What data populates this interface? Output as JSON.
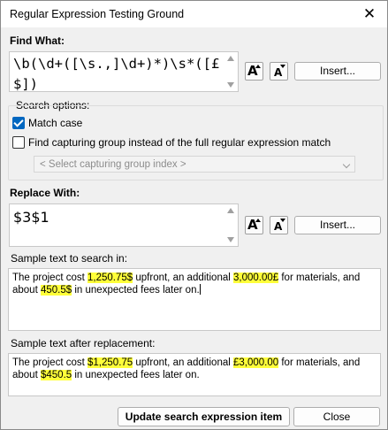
{
  "window": {
    "title": "Regular Expression Testing Ground"
  },
  "find": {
    "label": "Find What:",
    "expression": "\\b(\\d+([\\s.,]\\d+)*)\\s*([£$])",
    "insert_label": "Insert..."
  },
  "search_options": {
    "legend": "Search options:",
    "match_case": {
      "label": "Match case",
      "checked": true
    },
    "capturing_group": {
      "label": "Find capturing group instead of the full regular expression match",
      "checked": false
    },
    "group_select_placeholder": "< Select capturing group index >"
  },
  "replace": {
    "label": "Replace With:",
    "value": "$3$1",
    "insert_label": "Insert..."
  },
  "sample": {
    "label": "Sample text to search in:",
    "segments": [
      {
        "text": "The project cost ",
        "hl": false
      },
      {
        "text": "1,250.75$",
        "hl": true
      },
      {
        "text": " upfront, an additional ",
        "hl": false
      },
      {
        "text": "3,000.00£",
        "hl": true
      },
      {
        "text": " for materials, and about ",
        "hl": false
      },
      {
        "text": "450.5$",
        "hl": true
      },
      {
        "text": " in unexpected fees later on.",
        "hl": false
      }
    ]
  },
  "result": {
    "label": "Sample text after replacement:",
    "segments": [
      {
        "text": "The project cost ",
        "hl": false
      },
      {
        "text": "$1,250.75",
        "hl": true
      },
      {
        "text": " upfront, an additional ",
        "hl": false
      },
      {
        "text": "£3,000.00",
        "hl": true
      },
      {
        "text": " for materials, and about ",
        "hl": false
      },
      {
        "text": "$450.5",
        "hl": true
      },
      {
        "text": " in unexpected fees later on.",
        "hl": false
      }
    ]
  },
  "buttons": {
    "update": "Update search expression item",
    "close": "Close"
  },
  "icons": {
    "close": "close-icon",
    "font_increase": "font-size-increase-icon",
    "font_decrease": "font-size-decrease-icon",
    "scroll_up": "scroll-up-arrow-icon",
    "scroll_down": "scroll-down-arrow-icon",
    "dropdown": "chevron-down-icon",
    "checkmark": "checkmark-icon"
  },
  "colors": {
    "highlight": "#ffff3a",
    "checkbox_accent": "#0067c0"
  }
}
